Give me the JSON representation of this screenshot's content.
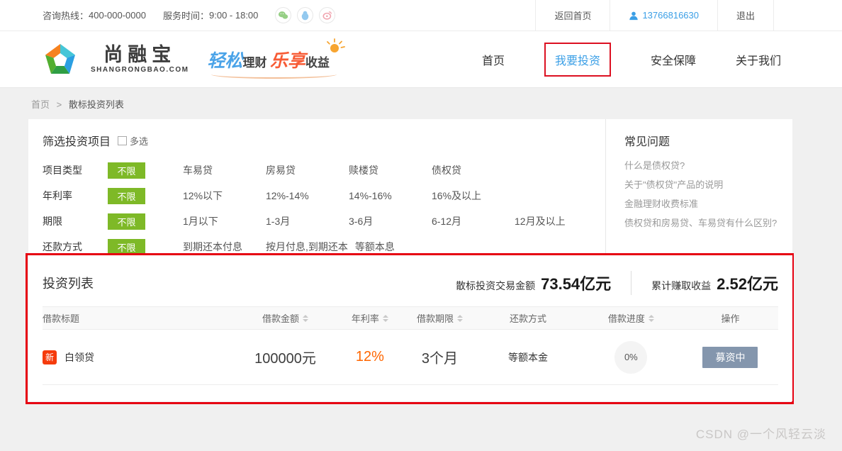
{
  "topbar": {
    "hotline_label": "咨询热线：",
    "hotline_number": "400-000-0000",
    "service_label": "服务时间：",
    "service_time": "9:00 - 18:00",
    "back_home": "返回首页",
    "phone": "13766816630",
    "logout": "退出"
  },
  "header": {
    "brand": "尚融宝",
    "brand_sub": "SHANGRONGBAO.COM",
    "slogan": {
      "p1": "轻松",
      "p2": "理财",
      "p3": "乐享",
      "p4": "收益"
    },
    "nav": [
      {
        "label": "首页"
      },
      {
        "label": "我要投资"
      },
      {
        "label": "安全保障"
      },
      {
        "label": "关于我们"
      }
    ]
  },
  "breadcrumb": {
    "home": "首页",
    "sep": ">",
    "current": "散标投资列表"
  },
  "filter": {
    "title": "筛选投资项目",
    "multi_label": "多选",
    "rows": [
      {
        "label": "项目类型",
        "selected": "不限",
        "options": [
          "车易贷",
          "房易贷",
          "赎楼贷",
          "债权贷"
        ]
      },
      {
        "label": "年利率",
        "selected": "不限",
        "options": [
          "12%以下",
          "12%-14%",
          "14%-16%",
          "16%及以上"
        ]
      },
      {
        "label": "期限",
        "selected": "不限",
        "options": [
          "1月以下",
          "1-3月",
          "3-6月",
          "6-12月",
          "12月及以上"
        ]
      },
      {
        "label": "还款方式",
        "selected": "不限",
        "options": [
          "到期还本付息",
          "按月付息,到期还本",
          "等额本息"
        ]
      }
    ]
  },
  "faq": {
    "title": "常见问题",
    "items": [
      "什么是债权贷?",
      "关于\"债权贷\"产品的说明",
      "金融理财收费标准",
      "债权贷和房易贷、车易贷有什么区别?"
    ]
  },
  "list": {
    "title": "投资列表",
    "stats": [
      {
        "label": "散标投资交易金额",
        "value": "73.54亿元"
      },
      {
        "label": "累计赚取收益",
        "value": "2.52亿元"
      }
    ],
    "columns": [
      "借款标题",
      "借款金额",
      "年利率",
      "借款期限",
      "还款方式",
      "借款进度",
      "操作"
    ],
    "rows": [
      {
        "badge": "新",
        "title": "白领贷",
        "amount": "100000元",
        "rate": "12%",
        "period": "3个月",
        "repay": "等额本金",
        "progress": "0%",
        "action": "募资中"
      }
    ]
  },
  "icons": [
    "wechat-icon",
    "qq-icon",
    "weibo-icon",
    "user-icon",
    "sun-icon",
    "pentagon-logo"
  ],
  "colors": {
    "accent_blue": "#3b9fe6",
    "filter_green": "#7eb927",
    "annotation_red": "#e60012",
    "rate_orange": "#ff6600",
    "badge_red": "#f53b0c",
    "action_slate": "#8496ad"
  },
  "watermark": "CSDN @一个风轻云淡"
}
